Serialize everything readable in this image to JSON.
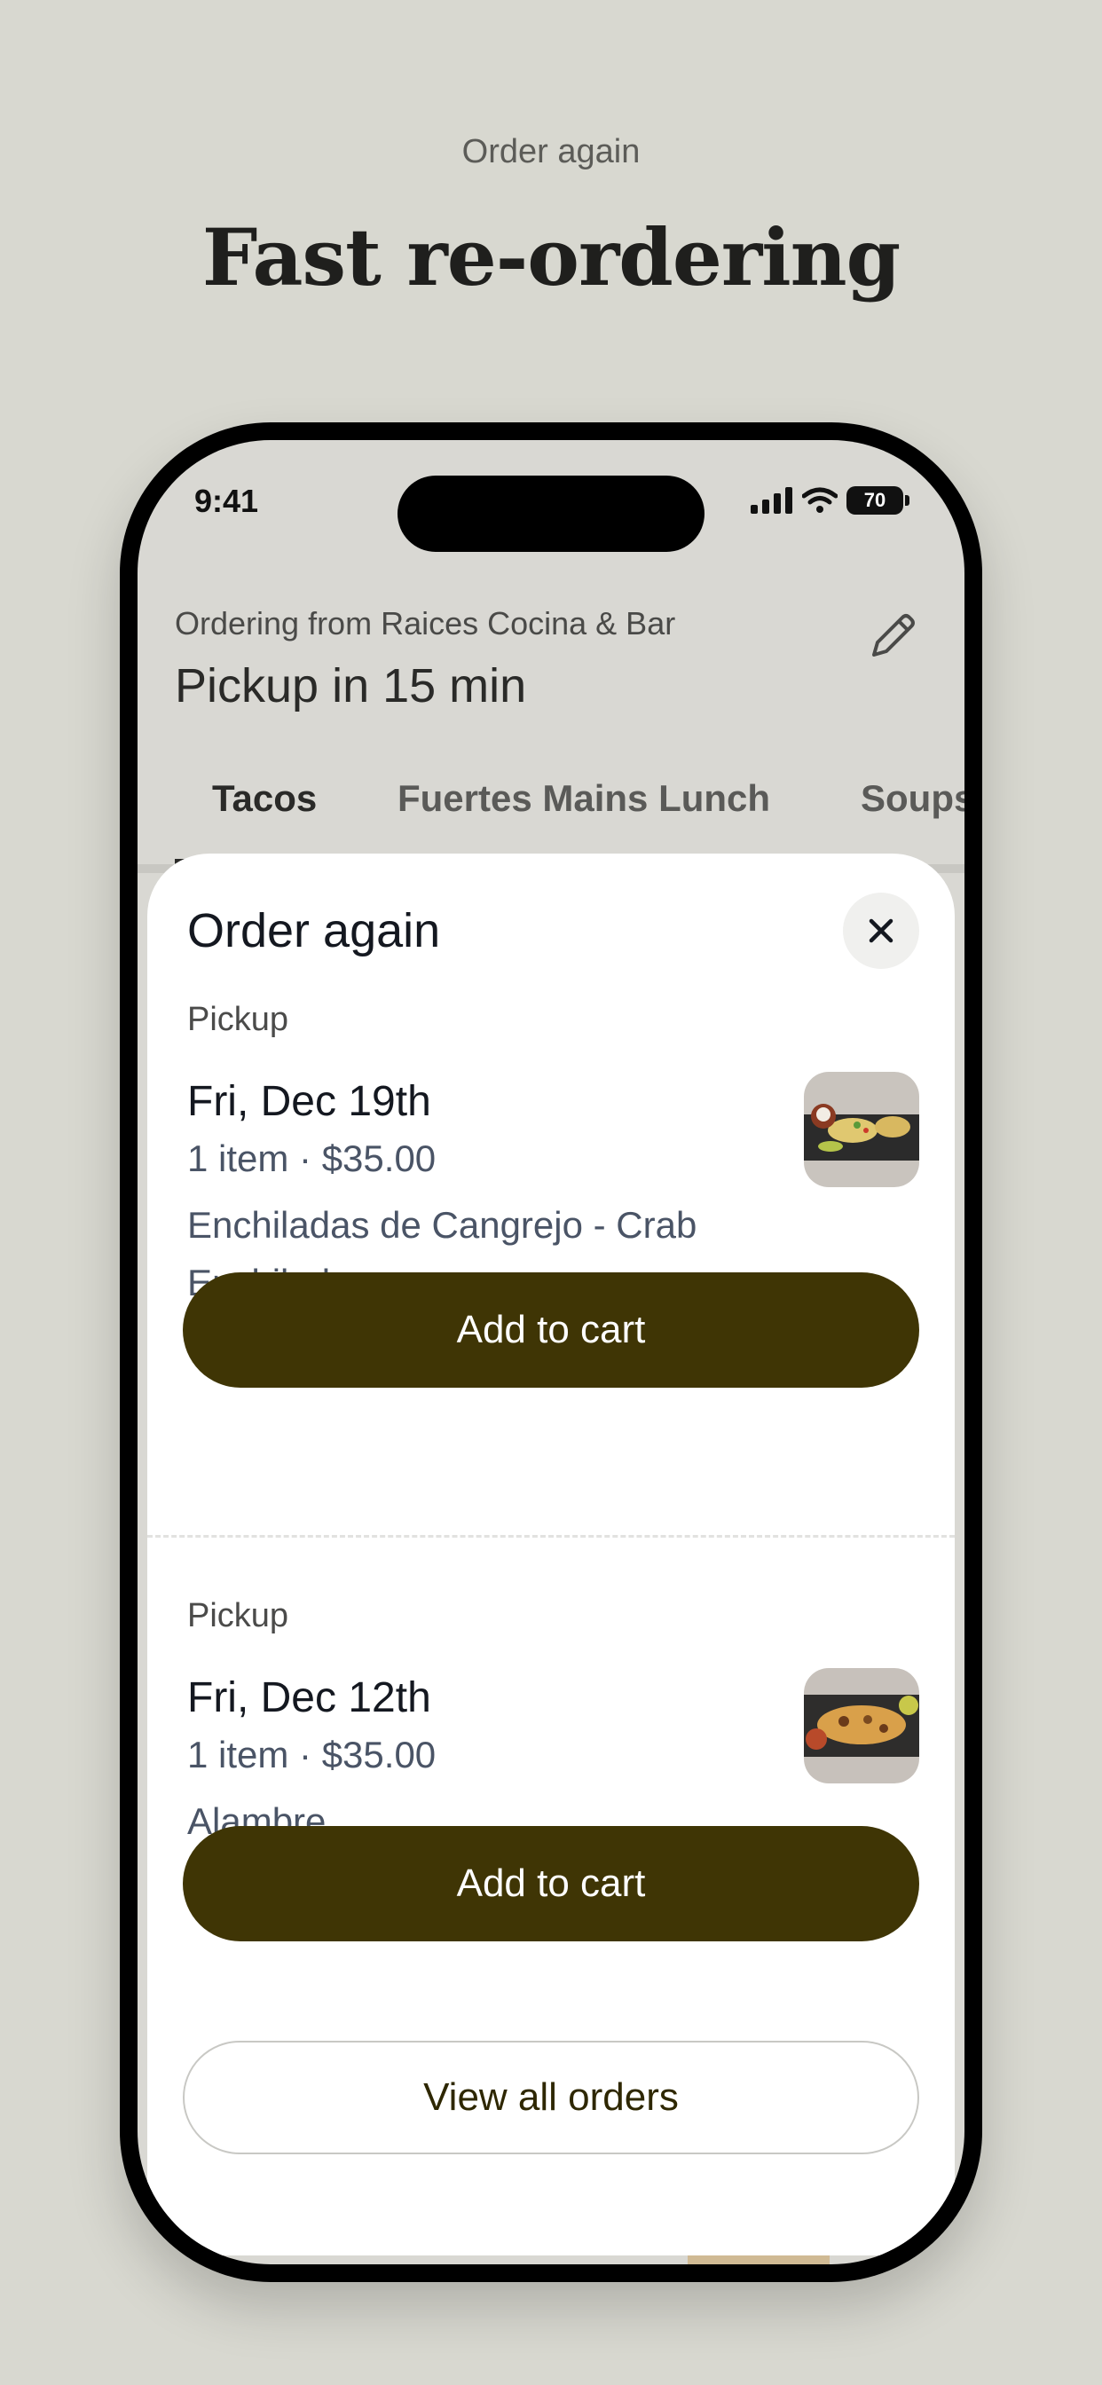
{
  "promo": {
    "eyebrow": "Order again",
    "headline": "Fast re-ordering"
  },
  "status_bar": {
    "time": "9:41",
    "battery": "70"
  },
  "header": {
    "ordering_from": "Ordering from Raices Cocina & Bar",
    "pickup_time": "Pickup in 15 min"
  },
  "tabs": [
    {
      "label": "Tacos"
    },
    {
      "label": "Fuertes Mains Lunch"
    },
    {
      "label": "Soups"
    }
  ],
  "sheet": {
    "title": "Order again",
    "orders": [
      {
        "type": "Pickup",
        "date": "Fri, Dec 19th",
        "summary": "1 item · $35.00",
        "items": "Enchiladas de Cangrejo - Crab Enchiladas",
        "button": "Add to cart"
      },
      {
        "type": "Pickup",
        "date": "Fri, Dec 12th",
        "summary": "1 item · $35.00",
        "items": "Alambre",
        "button": "Add to cart"
      }
    ],
    "view_all": "View all orders"
  },
  "colors": {
    "background": "#d8d8d0",
    "primary_button": "#3f3505",
    "text_dark": "#141820",
    "text_muted": "#4a5466"
  }
}
